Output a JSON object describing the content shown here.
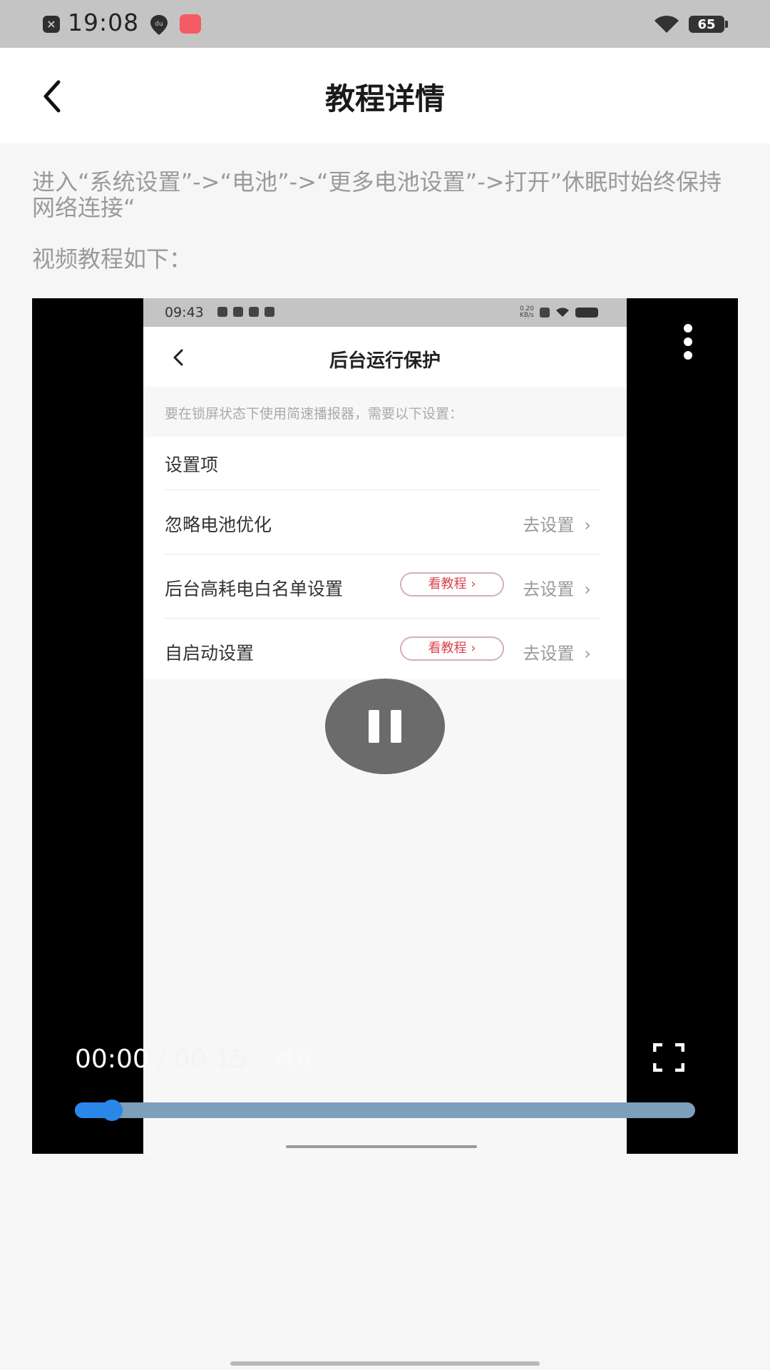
{
  "status_bar": {
    "time": "19:08",
    "battery": "65",
    "pin_label": "du",
    "x_label": "×"
  },
  "header": {
    "title": "教程详情"
  },
  "content": {
    "instruction": "进入“系统设置”->“电池”->“更多电池设置”->打开”休眠时始终保持网络连接“",
    "video_intro": "视频教程如下："
  },
  "video": {
    "current_time": "00:00",
    "separator": "/",
    "duration": "00:15",
    "progress_fraction": 0.06,
    "frame": {
      "status_time": "09:43",
      "net_speed_value": "0.20",
      "net_speed_unit": "KB/s",
      "title": "后台运行保护",
      "note": "要在锁屏状态下使用简速播报器，需要以下设置：",
      "header_row": "设置项",
      "rows": [
        {
          "label": "忽略电池优化",
          "action": "去设置"
        },
        {
          "label": "后台高耗电白名单设置",
          "tutorial": "看教程",
          "action": "去设置"
        },
        {
          "label": "自启动设置",
          "tutorial": "看教程",
          "action": "去设置"
        }
      ]
    }
  },
  "colors": {
    "accent_blue": "#2a86e8",
    "tutorial_red": "#d9434f"
  }
}
